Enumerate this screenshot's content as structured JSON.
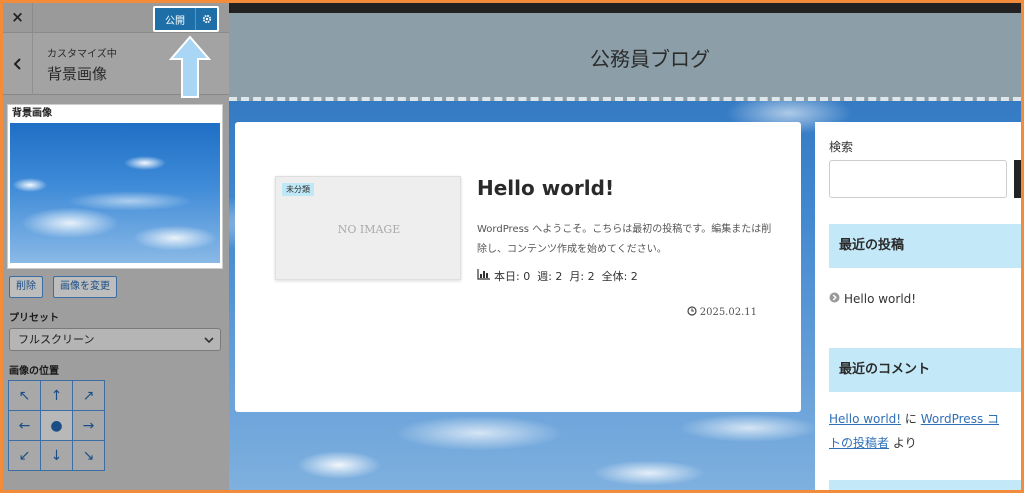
{
  "sidebar": {
    "close_label": "×",
    "publish_label": "公開",
    "subtitle": "カスタマイズ中",
    "title": "背景画像",
    "bg_section_label": "背景画像",
    "remove_label": "削除",
    "change_label": "画像を変更",
    "preset_label": "プリセット",
    "preset_value": "フルスクリーン",
    "position_label": "画像の位置",
    "position_grid": [
      "↖",
      "↑",
      "↗",
      "←",
      "●",
      "→",
      "↙",
      "↓",
      "↘"
    ],
    "accent_color": "#1e6fa8",
    "hint_arrow_color": "#a9d6f5"
  },
  "preview": {
    "site_title": "公務員ブログ",
    "post": {
      "category": "未分類",
      "thumbnail_text": "NO IMAGE",
      "title": "Hello world!",
      "excerpt": "WordPress へようこそ。こちらは最初の投稿です。編集または削除し、コンテンツ作成を始めてください。",
      "stats": "本日: 0  週: 2  月: 2  全体: 2",
      "date": "2025.02.11"
    },
    "widgets": {
      "search_label": "検索",
      "recent_posts_title": "最近の投稿",
      "recent_post_item": "Hello world!",
      "recent_comments_title": "最近のコメント",
      "comment_link_post": "Hello world!",
      "comment_ni": "に",
      "comment_author_part1": "WordPress コ",
      "comment_author_part2": "トの投稿者",
      "comment_yori": "より"
    }
  }
}
